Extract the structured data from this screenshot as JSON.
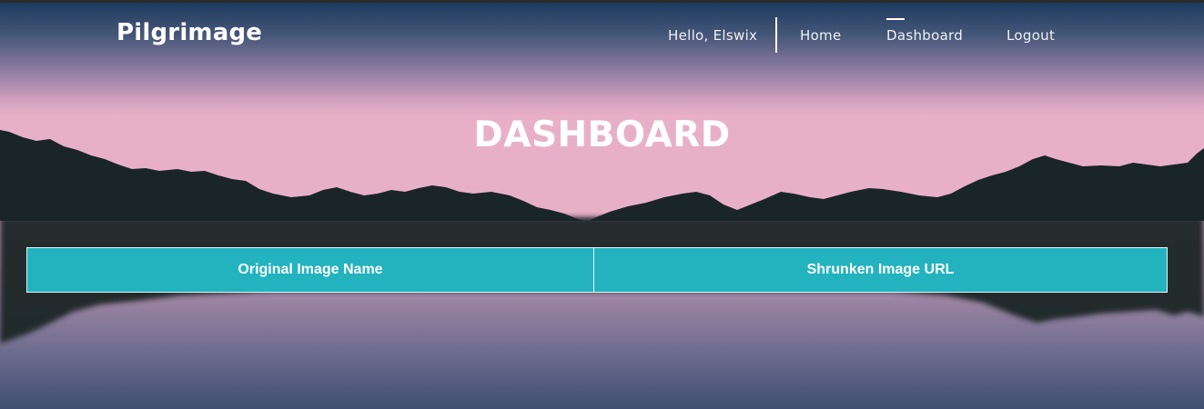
{
  "brand": {
    "name": "Pilgrimage"
  },
  "nav": {
    "greeting": "Hello, Elswix",
    "links": [
      {
        "label": "Home",
        "active": false
      },
      {
        "label": "Dashboard",
        "active": true
      },
      {
        "label": "Logout",
        "active": false
      }
    ]
  },
  "page": {
    "title": "DASHBOARD"
  },
  "table": {
    "headers": [
      "Original Image Name",
      "Shrunken Image URL"
    ],
    "rows": []
  },
  "colors": {
    "sky_top": "#1e3a5f",
    "sky_glow": "#e8b0c6",
    "mountain": "#1a2527",
    "header_cell": "#22b3bf",
    "text": "#ffffff"
  }
}
